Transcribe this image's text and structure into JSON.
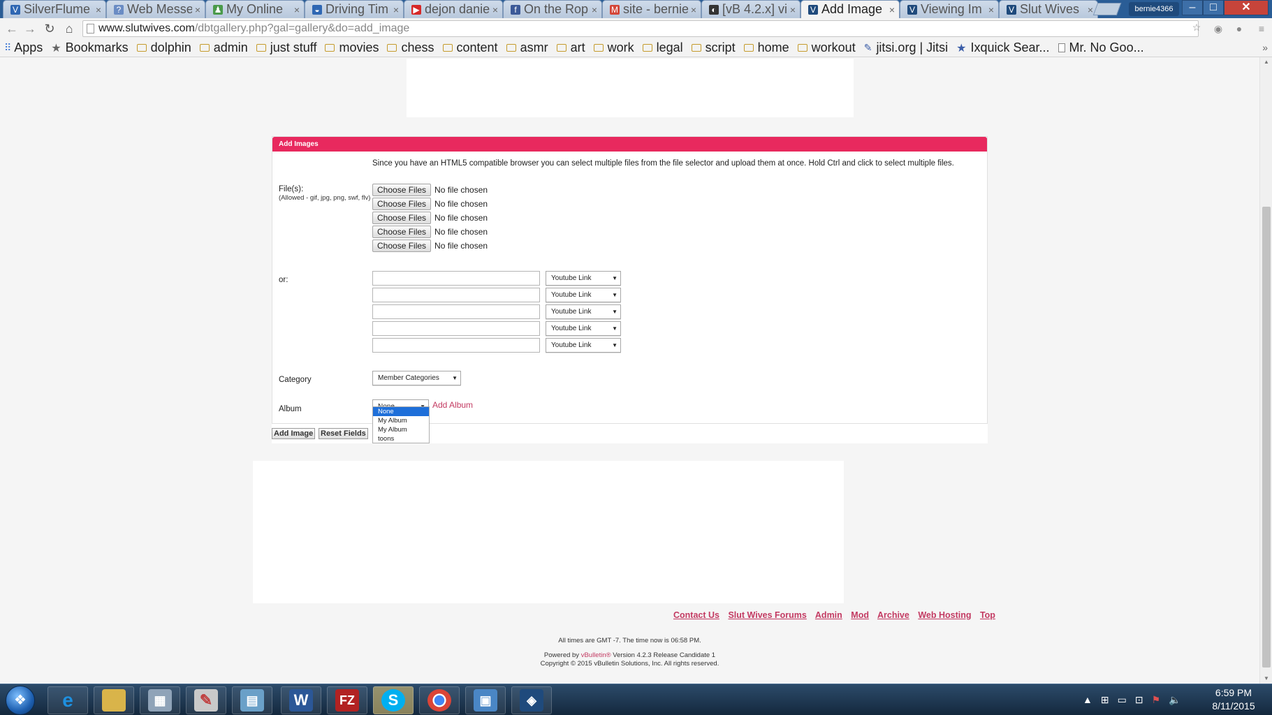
{
  "browser": {
    "tabs": [
      {
        "title": "SilverFlume",
        "favicon": "vbulletin-icon",
        "color": "#2f67b3",
        "active": false
      },
      {
        "title": "Web Messe",
        "favicon": "chat-icon",
        "color": "#6a8cc4",
        "active": false
      },
      {
        "title": "My Online",
        "favicon": "person-icon",
        "color": "#4a9a4a",
        "active": false
      },
      {
        "title": "Driving Tim",
        "favicon": "globe-icon",
        "color": "#2f67b3",
        "active": false
      },
      {
        "title": "dejon danie",
        "favicon": "youtube-icon",
        "color": "#d62828",
        "active": false
      },
      {
        "title": "On the Rop",
        "favicon": "facebook-icon",
        "color": "#3b5998",
        "active": false
      },
      {
        "title": "site - bernie",
        "favicon": "gmail-icon",
        "color": "#d44638",
        "active": false
      },
      {
        "title": "[vB 4.2.x] vi",
        "favicon": "vb-forum-icon",
        "color": "#333333",
        "active": false
      },
      {
        "title": "Add Image",
        "favicon": "vbulletin-icon",
        "color": "#1f4a7c",
        "active": true
      },
      {
        "title": "Viewing Im",
        "favicon": "vbulletin-icon",
        "color": "#1f4a7c",
        "active": false
      },
      {
        "title": "Slut Wives",
        "favicon": "vbulletin-icon",
        "color": "#1f4a7c",
        "active": false
      }
    ],
    "user_badge": "bernie4366",
    "url_host": "www.slutwives.com",
    "url_path": "/dbtgallery.php?gal=gallery&do=add_image"
  },
  "bookmarks": [
    {
      "label": "Apps",
      "icon": "apps-grid-icon"
    },
    {
      "label": "Bookmarks",
      "icon": "star-icon"
    },
    {
      "label": "dolphin",
      "icon": "folder-icon"
    },
    {
      "label": "admin",
      "icon": "folder-icon"
    },
    {
      "label": "just stuff",
      "icon": "folder-icon"
    },
    {
      "label": "movies",
      "icon": "folder-icon"
    },
    {
      "label": "chess",
      "icon": "folder-icon"
    },
    {
      "label": "content",
      "icon": "folder-icon"
    },
    {
      "label": "asmr",
      "icon": "folder-icon"
    },
    {
      "label": "art",
      "icon": "folder-icon"
    },
    {
      "label": "work",
      "icon": "folder-icon"
    },
    {
      "label": "legal",
      "icon": "folder-icon"
    },
    {
      "label": "script",
      "icon": "folder-icon"
    },
    {
      "label": "home",
      "icon": "folder-icon"
    },
    {
      "label": "workout",
      "icon": "folder-icon"
    },
    {
      "label": "jitsi.org | Jitsi",
      "icon": "link-icon"
    },
    {
      "label": "Ixquick Sear...",
      "icon": "star-icon"
    },
    {
      "label": "Mr. No Goo...",
      "icon": "page-icon"
    }
  ],
  "form": {
    "header": "Add Images",
    "intro": "Since you have an HTML5 compatible browser you can select multiple files from the file selector and upload them at once. Hold Ctrl and click to select multiple files.",
    "files_label": "File(s):",
    "files_allowed": "(Allowed - gif, jpg, png, swf, flv)",
    "file_rows": [
      {
        "button": "Choose Files",
        "status": "No file chosen"
      },
      {
        "button": "Choose Files",
        "status": "No file chosen"
      },
      {
        "button": "Choose Files",
        "status": "No file chosen"
      },
      {
        "button": "Choose Files",
        "status": "No file chosen"
      },
      {
        "button": "Choose Files",
        "status": "No file chosen"
      }
    ],
    "or_label": "or:",
    "link_rows": [
      {
        "value": "",
        "type": "Youtube Link"
      },
      {
        "value": "",
        "type": "Youtube Link"
      },
      {
        "value": "",
        "type": "Youtube Link"
      },
      {
        "value": "",
        "type": "Youtube Link"
      },
      {
        "value": "",
        "type": "Youtube Link"
      }
    ],
    "category_label": "Category",
    "category_value": "Member Categories",
    "album_label": "Album",
    "album_value": "None",
    "album_options": [
      "None",
      "My Album",
      "My Album",
      "toons"
    ],
    "add_album": "Add Album",
    "submit": "Add Image",
    "reset": "Reset Fields"
  },
  "footer": {
    "links": [
      "Contact Us",
      "Slut Wives Forums",
      "Admin",
      "Mod",
      "Archive",
      "Web Hosting",
      "Top"
    ],
    "time_text": "All times are GMT -7. The time now is 06:58 PM.",
    "powered_prefix": "Powered by ",
    "powered_brand": "vBulletin®",
    "powered_suffix": " Version 4.2.3 Release Candidate 1",
    "copyright": "Copyright © 2015 vBulletin Solutions, Inc. All rights reserved."
  },
  "taskbar": {
    "apps": [
      {
        "name": "internet-explorer",
        "glyph": "e",
        "color": "#1e90e0"
      },
      {
        "name": "file-explorer",
        "glyph": "▬",
        "color": "#d9b44a"
      },
      {
        "name": "calculator",
        "glyph": "▦",
        "color": "#8fa3b8"
      },
      {
        "name": "paint",
        "glyph": "✎",
        "color": "#c9c9c9"
      },
      {
        "name": "notepad",
        "glyph": "▤",
        "color": "#6aa0c8"
      },
      {
        "name": "word",
        "glyph": "W",
        "color": "#2b5797"
      },
      {
        "name": "filezilla",
        "glyph": "FZ",
        "color": "#b22222"
      },
      {
        "name": "skype",
        "glyph": "S",
        "color": "#00aff0"
      },
      {
        "name": "chrome",
        "glyph": "◉",
        "color": "#db4437"
      },
      {
        "name": "remote-desktop",
        "glyph": "▣",
        "color": "#4a86c5"
      },
      {
        "name": "vbulletin-app",
        "glyph": "◈",
        "color": "#1f4a7c"
      }
    ],
    "time": "6:59 PM",
    "date": "8/11/2015"
  }
}
